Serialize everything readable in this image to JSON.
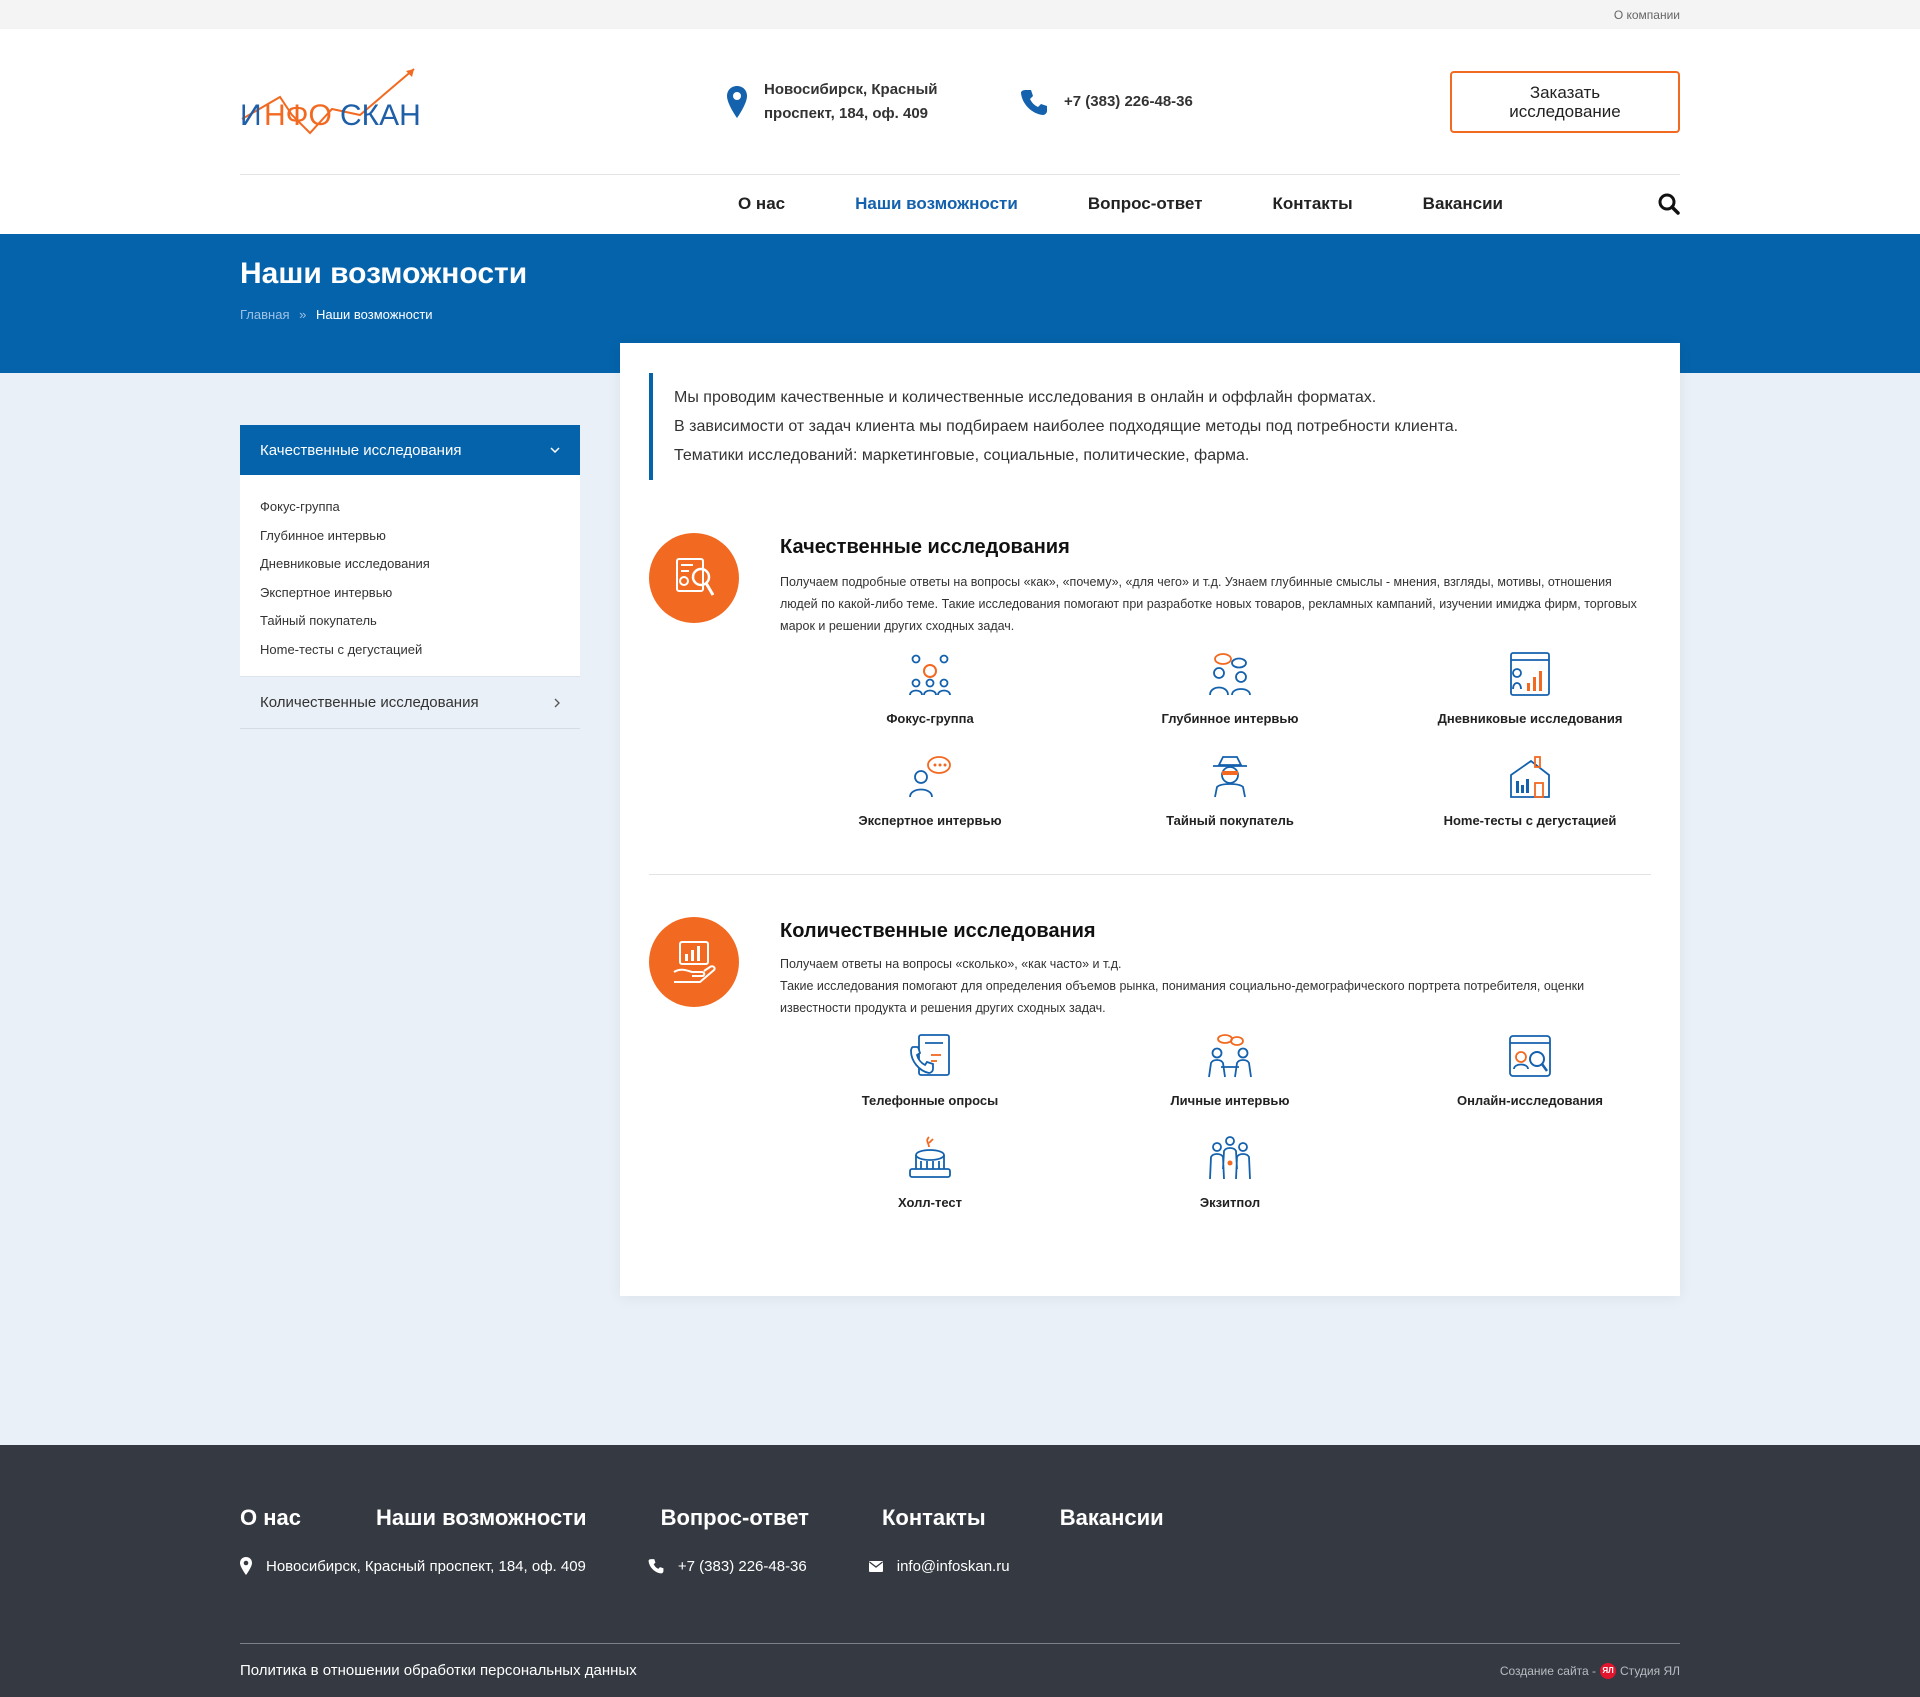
{
  "topbar": {
    "about_link": "О компании"
  },
  "header": {
    "address": "Новосибирск,  Красный проспект, 184, оф. 409",
    "phone": "+7 (383) 226-48-36",
    "cta_label": "Заказать исследование",
    "logo_text": "ИНФО СКАН"
  },
  "nav": {
    "items": [
      "О нас",
      "Наши возможности",
      "Вопрос-ответ",
      "Контакты",
      "Вакансии"
    ],
    "active": "Наши возможности"
  },
  "banner": {
    "title": "Наши возможности",
    "breadcrumb_home": "Главная",
    "breadcrumb_sep": "»",
    "breadcrumb_current": "Наши возможности"
  },
  "sidebar": {
    "open_title": "Качественные исследования",
    "items": [
      "Фокус-группа",
      "Глубинное интервью",
      "Дневниковые исследования",
      "Экспертное интервью",
      "Тайный покупатель",
      "Home-тесты с дегустацией"
    ],
    "closed_title": "Количественные исследования"
  },
  "intro": {
    "lines": [
      "Мы проводим качественные и количественные исследования в онлайн и оффлайн форматах.",
      "В зависимости от задач клиента мы подбираем наиболее подходящие методы под потребности клиента.",
      "Тематики исследований: маркетинговые, социальные, политические, фарма."
    ]
  },
  "sections": [
    {
      "title": "Качественные исследования",
      "text": "Получаем подробные ответы на вопросы «как», «почему», «для чего» и т.д. Узнаем глубинные смыслы - мнения, взгляды, мотивы, отношения людей по какой-либо теме. Такие исследования помогают при разработке новых товаров, рекламных кампаний, изучении имиджа фирм, торговых марок и решении других сходных задач.",
      "items": [
        "Фокус-группа",
        "Глубинное интервью",
        "Дневниковые исследования",
        "Экспертное интервью",
        "Тайный покупатель",
        "Home-тесты с дегустацией"
      ]
    },
    {
      "title": "Количественные исследования",
      "text_line1": "Получаем ответы на вопросы «сколько», «как часто» и т.д.",
      "text_line2": "Такие исследования помогают для определения объемов рынка, понимания социально-демографического портрета потребителя, оценки известности продукта и решения других сходных задач.",
      "items": [
        "Телефонные опросы",
        "Личные интервью",
        "Онлайн-исследования",
        "Холл-тест",
        "Экзитпол"
      ]
    }
  ],
  "footer": {
    "nav": [
      "О нас",
      "Наши возможности",
      "Вопрос-ответ",
      "Контакты",
      "Вакансии"
    ],
    "address": "Новосибирск,  Красный проспект, 184, оф. 409",
    "phone": "+7 (383) 226-48-36",
    "email": "info@infoskan.ru",
    "policy": "Политика в отношении обработки персональных данных",
    "studio_prefix": "Создание сайта -",
    "studio_badge": "ЯЛ",
    "studio_name": "Студия ЯЛ"
  },
  "colors": {
    "brand_blue": "#0563ab",
    "accent_orange": "#f26a21",
    "footer_bg": "#353a42",
    "page_bg": "#e9f0f7"
  }
}
